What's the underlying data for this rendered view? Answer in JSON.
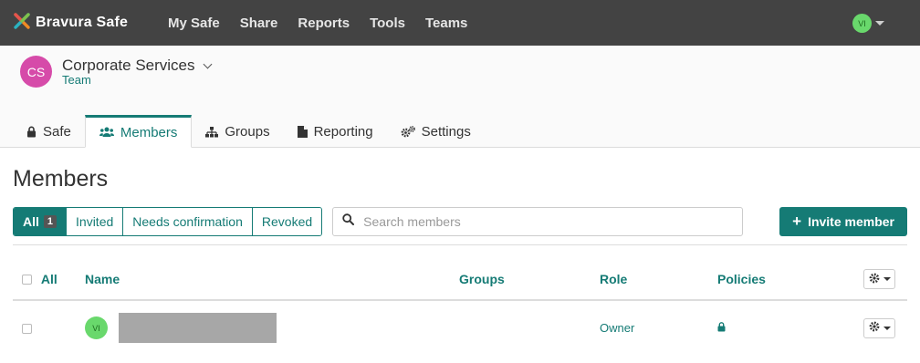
{
  "navbar": {
    "brand": "Bravura Safe",
    "items": [
      "My Safe",
      "Share",
      "Reports",
      "Tools",
      "Teams"
    ],
    "user_initials": "VI"
  },
  "org": {
    "initials": "CS",
    "name": "Corporate Services",
    "type": "Team"
  },
  "tabs": [
    {
      "label": "Safe",
      "icon": "lock-icon"
    },
    {
      "label": "Members",
      "icon": "users-icon",
      "active": true
    },
    {
      "label": "Groups",
      "icon": "sitemap-icon"
    },
    {
      "label": "Reporting",
      "icon": "file-icon"
    },
    {
      "label": "Settings",
      "icon": "cogs-icon"
    }
  ],
  "page": {
    "title": "Members"
  },
  "filters": {
    "all_label": "All",
    "all_count": "1",
    "invited": "Invited",
    "needs_confirmation": "Needs confirmation",
    "revoked": "Revoked"
  },
  "search": {
    "placeholder": "Search members",
    "value": ""
  },
  "invite_button": "Invite member",
  "table": {
    "select_all_label": "All",
    "columns": [
      "Name",
      "Groups",
      "Role",
      "Policies"
    ],
    "rows": [
      {
        "initials": "VI",
        "name": "",
        "groups": "",
        "role": "Owner",
        "policy_icon": "lock-icon"
      }
    ]
  },
  "colors": {
    "accent": "#157b75",
    "navbar": "#434343",
    "org_avatar": "#d64ba9",
    "user_avatar": "#69d86c"
  }
}
